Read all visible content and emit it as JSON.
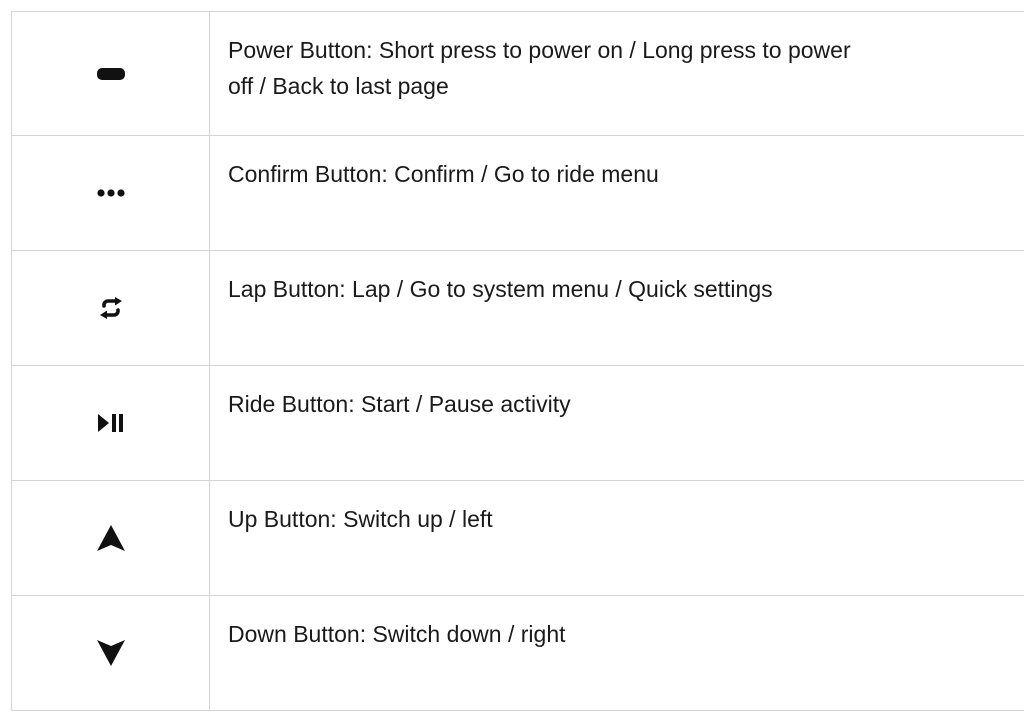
{
  "buttons": [
    {
      "icon": "minus-bar-icon",
      "lines": [
        "Power Button: Short press to power on / Long press to power",
        "off / Back to last page"
      ]
    },
    {
      "icon": "ellipsis-icon",
      "lines": [
        "Confirm Button: Confirm / Go to ride menu"
      ]
    },
    {
      "icon": "loop-arrows-icon",
      "lines": [
        "Lap Button: Lap / Go to system menu / Quick settings"
      ]
    },
    {
      "icon": "play-pause-icon",
      "lines": [
        "Ride Button: Start / Pause activity"
      ]
    },
    {
      "icon": "up-arrow-icon",
      "lines": [
        "Up Button: Switch up / left"
      ]
    },
    {
      "icon": "down-arrow-icon",
      "lines": [
        "Down Button: Switch down / right"
      ]
    }
  ]
}
